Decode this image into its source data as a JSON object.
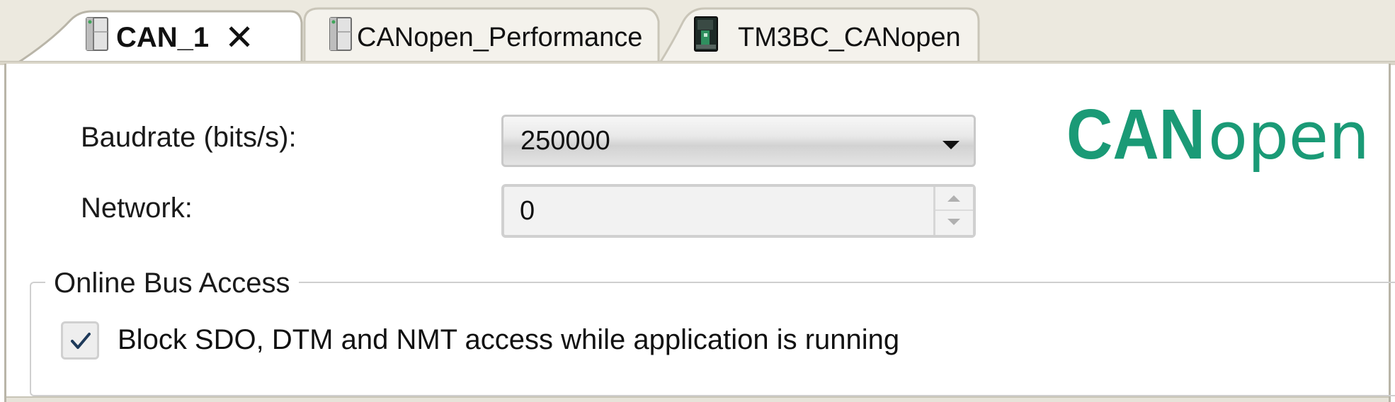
{
  "tabs": [
    {
      "label": "CAN_1",
      "active": true,
      "icon": "device-module-icon",
      "closable": true
    },
    {
      "label": "CANopen_Performance",
      "active": false,
      "icon": "device-module-icon"
    },
    {
      "label": "TM3BC_CANopen",
      "active": false,
      "icon": "tm3bc-device-icon"
    }
  ],
  "close_glyph": "✕",
  "fields": {
    "baudrate": {
      "label": "Baudrate (bits/s):",
      "value": "250000"
    },
    "network": {
      "label": "Network:",
      "value": "0"
    }
  },
  "logo": {
    "bold_text": "CAN",
    "light_text": "open",
    "color": "#1a9a76"
  },
  "online_bus_access": {
    "title": "Online Bus Access",
    "block_access": {
      "label": "Block SDO, DTM and NMT access while application is running",
      "checked": true
    }
  },
  "colors": {
    "tab_background": "#ece9df",
    "accent_check": "#1e3a5a"
  }
}
